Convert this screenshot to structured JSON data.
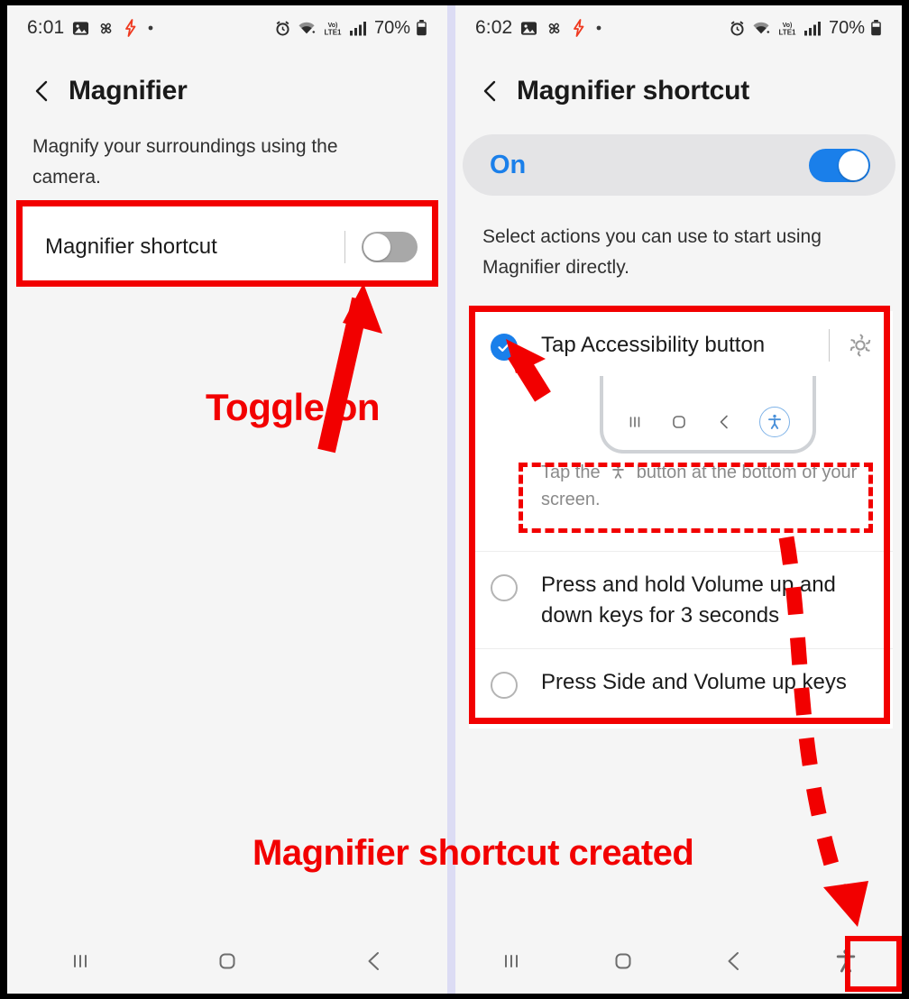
{
  "screens": {
    "left": {
      "status_bar": {
        "time": "6:01",
        "battery": "70%",
        "left_icons": [
          "image-icon",
          "pinwheel-icon",
          "lightning-bolt-icon",
          "dot-icon"
        ],
        "right_icons": [
          "alarm-icon",
          "wifi-icon",
          "volte-lte1-icon",
          "signal-bars-icon",
          "battery-icon"
        ]
      },
      "header": {
        "back_label": "back-chevron",
        "title": "Magnifier"
      },
      "description": "Magnify your surroundings using the camera.",
      "setting_row": {
        "label": "Magnifier shortcut",
        "toggle_state": "off"
      },
      "nav_bar": {
        "recents": "recents-icon",
        "home": "home-icon",
        "back": "back-icon"
      }
    },
    "right": {
      "status_bar": {
        "time": "6:02",
        "battery": "70%",
        "left_icons": [
          "image-icon",
          "pinwheel-icon",
          "lightning-bolt-icon",
          "dot-icon"
        ],
        "right_icons": [
          "alarm-icon",
          "wifi-icon",
          "volte-lte1-icon",
          "signal-bars-icon",
          "battery-icon"
        ]
      },
      "header": {
        "back_label": "back-chevron",
        "title": "Magnifier shortcut"
      },
      "banner": {
        "label": "On",
        "toggle_state": "on"
      },
      "description": "Select actions you can use to start using Magnifier directly.",
      "options": [
        {
          "label": "Tap Accessibility button",
          "selected": true,
          "has_settings_gear": true,
          "hint": "Tap the ı button at the bottom of your screen.",
          "hint_prefix": "Tap the",
          "hint_suffix": "button at the bottom of your screen.",
          "preview_icons": [
            "recents-icon",
            "home-icon",
            "back-icon",
            "accessibility-icon"
          ]
        },
        {
          "label": "Press and hold Volume up and down keys for 3 seconds",
          "selected": false,
          "has_settings_gear": false
        },
        {
          "label": "Press Side and Volume up keys",
          "selected": false,
          "has_settings_gear": false
        }
      ],
      "nav_bar": {
        "recents": "recents-icon",
        "home": "home-icon",
        "back": "back-icon",
        "accessibility": "accessibility-icon"
      }
    }
  },
  "annotations": {
    "toggle_on_caption": "Toggle on",
    "shortcut_created_caption": "Magnifier shortcut created",
    "accent_color": "#f20000"
  },
  "colors": {
    "accent_red": "#f20000",
    "toggle_on_blue": "#1a7fea",
    "toggle_off_gray": "#a8a8a8",
    "panel_bg": "#f5f5f5",
    "card_bg": "#ffffff",
    "banner_bg": "#e4e4e6",
    "hint_text": "#8a8a8a"
  }
}
